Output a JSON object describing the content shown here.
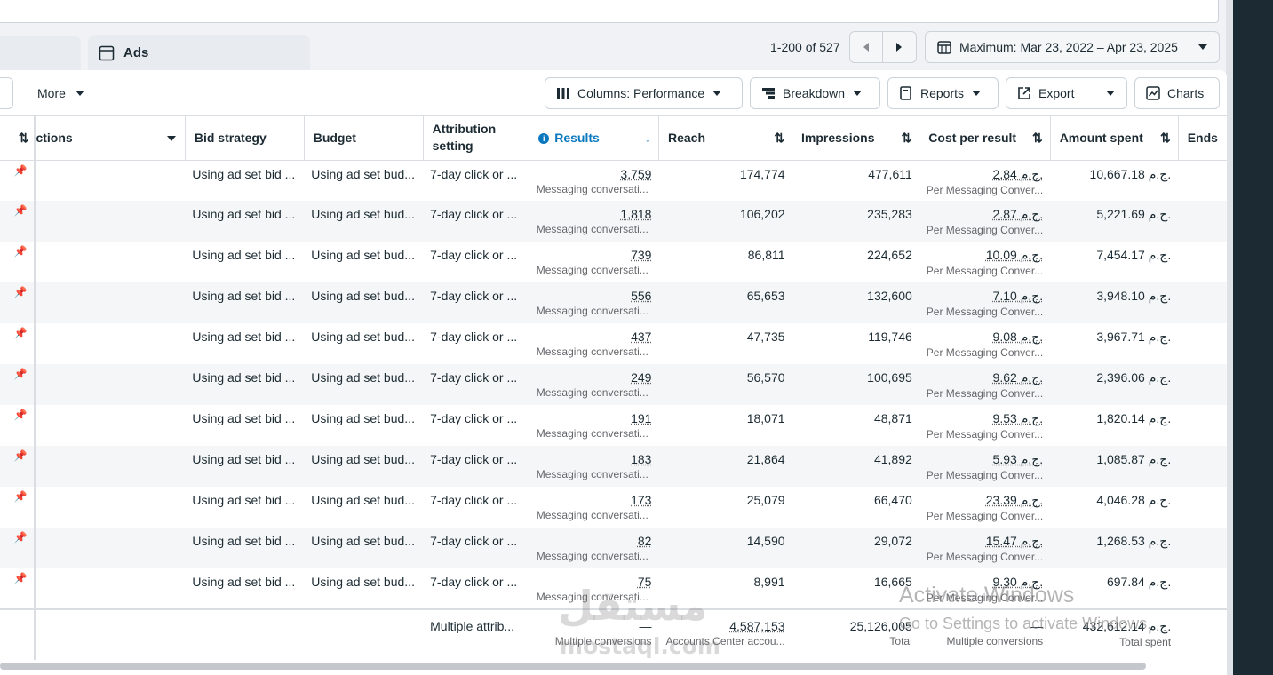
{
  "tabs": {
    "ads_label": "Ads"
  },
  "pagination": {
    "range_text": "1-200 of 527"
  },
  "date_range": {
    "label": "Maximum: Mar 23, 2022 – Apr 23, 2025"
  },
  "toolbar": {
    "more_label": "More",
    "columns_label": "Columns: Performance",
    "breakdown_label": "Breakdown",
    "reports_label": "Reports",
    "export_label": "Export",
    "charts_label": "Charts"
  },
  "table": {
    "headers": {
      "actions": "ctions",
      "bid_strategy": "Bid strategy",
      "budget": "Budget",
      "attribution_line1": "Attribution",
      "attribution_line2": "setting",
      "results": "Results",
      "reach": "Reach",
      "impressions": "Impressions",
      "cost_per_result": "Cost per result",
      "amount_spent": "Amount spent",
      "ends": "Ends"
    },
    "rows": [
      {
        "bid": "Using ad set bid ...",
        "budget": "Using ad set bud...",
        "attr": "7-day click or ...",
        "results": "3,759",
        "results_sub": "Messaging conversati...",
        "reach": "174,774",
        "impressions": "477,611",
        "cpr": "2.84 ج.م.",
        "cpr_sub": "Per Messaging Conver...",
        "spent": "10,667.18 ج.م."
      },
      {
        "bid": "Using ad set bid ...",
        "budget": "Using ad set bud...",
        "attr": "7-day click or ...",
        "results": "1,818",
        "results_sub": "Messaging conversati...",
        "reach": "106,202",
        "impressions": "235,283",
        "cpr": "2.87 ج.م.",
        "cpr_sub": "Per Messaging Conver...",
        "spent": "5,221.69 ج.م."
      },
      {
        "bid": "Using ad set bid ...",
        "budget": "Using ad set bud...",
        "attr": "7-day click or ...",
        "results": "739",
        "results_sub": "Messaging conversati...",
        "reach": "86,811",
        "impressions": "224,652",
        "cpr": "10.09 ج.م.",
        "cpr_sub": "Per Messaging Conver...",
        "spent": "7,454.17 ج.م."
      },
      {
        "bid": "Using ad set bid ...",
        "budget": "Using ad set bud...",
        "attr": "7-day click or ...",
        "results": "556",
        "results_sub": "Messaging conversati...",
        "reach": "65,653",
        "impressions": "132,600",
        "cpr": "7.10 ج.م.",
        "cpr_sub": "Per Messaging Conver...",
        "spent": "3,948.10 ج.م."
      },
      {
        "bid": "Using ad set bid ...",
        "budget": "Using ad set bud...",
        "attr": "7-day click or ...",
        "results": "437",
        "results_sub": "Messaging conversati...",
        "reach": "47,735",
        "impressions": "119,746",
        "cpr": "9.08 ج.م.",
        "cpr_sub": "Per Messaging Conver...",
        "spent": "3,967.71 ج.م."
      },
      {
        "bid": "Using ad set bid ...",
        "budget": "Using ad set bud...",
        "attr": "7-day click or ...",
        "results": "249",
        "results_sub": "Messaging conversati...",
        "reach": "56,570",
        "impressions": "100,695",
        "cpr": "9.62 ج.م.",
        "cpr_sub": "Per Messaging Conver...",
        "spent": "2,396.06 ج.م."
      },
      {
        "bid": "Using ad set bid ...",
        "budget": "Using ad set bud...",
        "attr": "7-day click or ...",
        "results": "191",
        "results_sub": "Messaging conversati...",
        "reach": "18,071",
        "impressions": "48,871",
        "cpr": "9.53 ج.م.",
        "cpr_sub": "Per Messaging Conver...",
        "spent": "1,820.14 ج.م."
      },
      {
        "bid": "Using ad set bid ...",
        "budget": "Using ad set bud...",
        "attr": "7-day click or ...",
        "results": "183",
        "results_sub": "Messaging conversati...",
        "reach": "21,864",
        "impressions": "41,892",
        "cpr": "5.93 ج.م.",
        "cpr_sub": "Per Messaging Conver...",
        "spent": "1,085.87 ج.م."
      },
      {
        "bid": "Using ad set bid ...",
        "budget": "Using ad set bud...",
        "attr": "7-day click or ...",
        "results": "173",
        "results_sub": "Messaging conversati...",
        "reach": "25,079",
        "impressions": "66,470",
        "cpr": "23.39 ج.م.",
        "cpr_sub": "Per Messaging Conver...",
        "spent": "4,046.28 ج.م."
      },
      {
        "bid": "Using ad set bid ...",
        "budget": "Using ad set bud...",
        "attr": "7-day click or ...",
        "results": "82",
        "results_sub": "Messaging conversati...",
        "reach": "14,590",
        "impressions": "29,072",
        "cpr": "15.47 ج.م.",
        "cpr_sub": "Per Messaging Conver...",
        "spent": "1,268.53 ج.م."
      },
      {
        "bid": "Using ad set bid ...",
        "budget": "Using ad set bud...",
        "attr": "7-day click or ...",
        "results": "75",
        "results_sub": "Messaging conversati...",
        "reach": "8,991",
        "impressions": "16,665",
        "cpr": "9.30 ج.م.",
        "cpr_sub": "Per Messaging Conver...",
        "spent": "697.84 ج.م."
      }
    ],
    "totals": {
      "attr": "Multiple attrib...",
      "results": "—",
      "results_sub": "Multiple conversions",
      "reach": "4,587,153",
      "reach_sub": "Accounts Center accou...",
      "impressions": "25,126,005",
      "impressions_sub": "Total",
      "cpr": "—",
      "cpr_sub": "Multiple conversions",
      "spent": "432,612.14 ج.م.",
      "spent_sub": "Total spent"
    }
  },
  "overlay": {
    "activate_title": "Activate Windows",
    "activate_sub": "Go to Settings to activate Windows.",
    "watermark_ar": "مستقل",
    "watermark_en": "mostaql.com"
  },
  "colors": {
    "accent": "#0a78be",
    "text": "#1c2b33",
    "border": "#cbd2d9"
  }
}
